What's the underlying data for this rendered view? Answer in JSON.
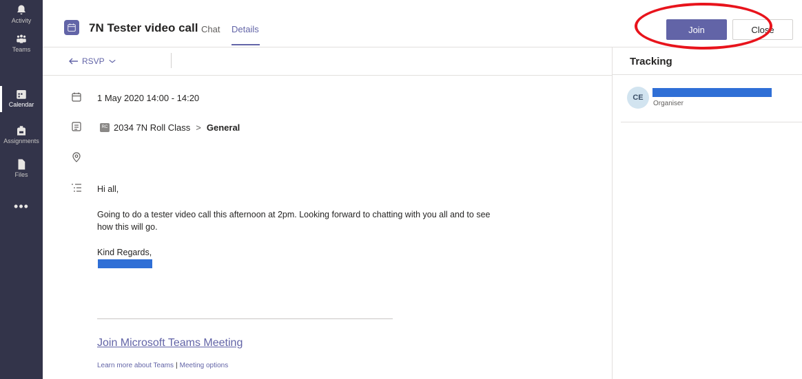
{
  "rail": {
    "items": [
      {
        "label": "Activity",
        "icon": "bell-icon"
      },
      {
        "label": "Teams",
        "icon": "teams-icon"
      },
      {
        "label": "Calendar",
        "icon": "calendar-icon"
      },
      {
        "label": "Assignments",
        "icon": "backpack-icon"
      },
      {
        "label": "Files",
        "icon": "file-icon"
      }
    ],
    "more": "•••",
    "active": "Calendar"
  },
  "header": {
    "title": "7N Tester video call",
    "tabs": [
      {
        "label": "Chat"
      },
      {
        "label": "Details"
      }
    ],
    "active_tab": "Details",
    "join_label": "Join",
    "close_label": "Close"
  },
  "toolbar": {
    "rsvp_label": "RSVP"
  },
  "details": {
    "datetime": "1 May 2020 14:00 - 14:20",
    "channel_badge": "RC",
    "team": "2034 7N Roll Class",
    "channel": "General",
    "greeting": "Hi all,",
    "message": "Going to do a tester video call this afternoon at 2pm. Looking forward to chatting with you all and to see how this will go.",
    "signoff": "Kind Regards,",
    "join_link": "Join Microsoft Teams Meeting",
    "learn_more": "Learn more about Teams",
    "separator": "|",
    "meeting_options": "Meeting options"
  },
  "tracking": {
    "title": "Tracking",
    "attendee_initials": "CE",
    "attendee_role": "Organiser"
  },
  "colors": {
    "rail": "#33344a",
    "accent": "#6264a7",
    "annotation": "#e8141c",
    "redaction": "#2f6fd6"
  }
}
